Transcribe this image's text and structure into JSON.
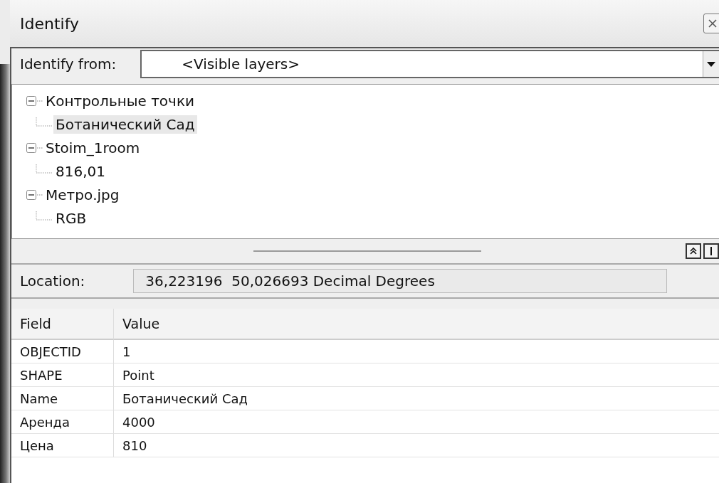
{
  "window": {
    "title": "Identify"
  },
  "identify_from": {
    "label": "Identify from:",
    "value": "<Visible layers>"
  },
  "tree": [
    {
      "label": "Контрольные точки",
      "expanded": true,
      "selected": false,
      "children": [
        {
          "label": "Ботанический Сад",
          "selected": true
        }
      ]
    },
    {
      "label": "Stoim_1room",
      "expanded": true,
      "selected": false,
      "children": [
        {
          "label": "816,01",
          "selected": false
        }
      ]
    },
    {
      "label": "Метро.jpg",
      "expanded": true,
      "selected": false,
      "children": [
        {
          "label": "RGB",
          "selected": false
        }
      ]
    }
  ],
  "location": {
    "label": "Location:",
    "value": "36,223196  50,026693 Decimal Degrees"
  },
  "table": {
    "columns": [
      "Field",
      "Value"
    ],
    "rows": [
      [
        "OBJECTID",
        "1"
      ],
      [
        "SHAPE",
        "Point"
      ],
      [
        "Name",
        "Ботанический Сад"
      ],
      [
        "Аренда",
        "4000"
      ],
      [
        "Цена",
        "810"
      ]
    ]
  }
}
